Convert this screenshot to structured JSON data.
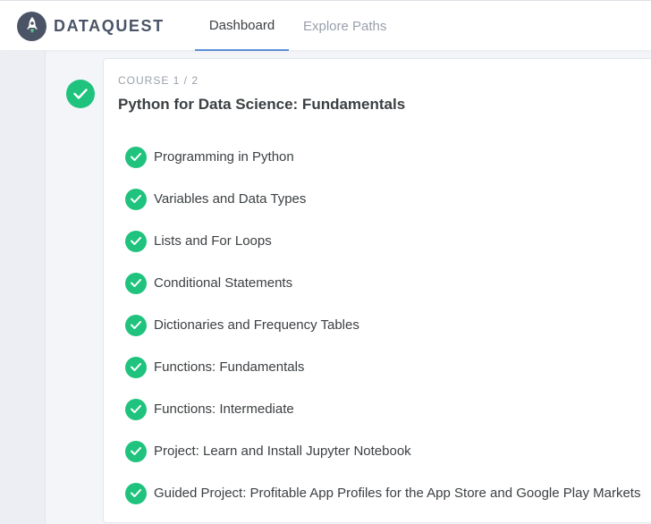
{
  "brand": {
    "name": "DATAQUEST",
    "logo_icon": "rocket-icon"
  },
  "nav": {
    "tabs": [
      {
        "label": "Dashboard",
        "active": true
      },
      {
        "label": "Explore Paths",
        "active": false
      }
    ]
  },
  "course": {
    "kicker": "COURSE 1 / 2",
    "title": "Python for Data Science: Fundamentals",
    "completed": true,
    "lessons": [
      {
        "label": "Programming in Python",
        "completed": true
      },
      {
        "label": "Variables and Data Types",
        "completed": true
      },
      {
        "label": "Lists and For Loops",
        "completed": true
      },
      {
        "label": "Conditional Statements",
        "completed": true
      },
      {
        "label": "Dictionaries and Frequency Tables",
        "completed": true
      },
      {
        "label": "Functions: Fundamentals",
        "completed": true
      },
      {
        "label": "Functions: Intermediate",
        "completed": true
      },
      {
        "label": "Project: Learn and Install Jupyter Notebook",
        "completed": true
      },
      {
        "label": "Guided Project: Profitable App Profiles for the App Store and Google Play Markets",
        "completed": true
      }
    ]
  },
  "colors": {
    "accent": "#5a8fd6",
    "success": "#1fc37d",
    "brand": "#4a5466"
  }
}
